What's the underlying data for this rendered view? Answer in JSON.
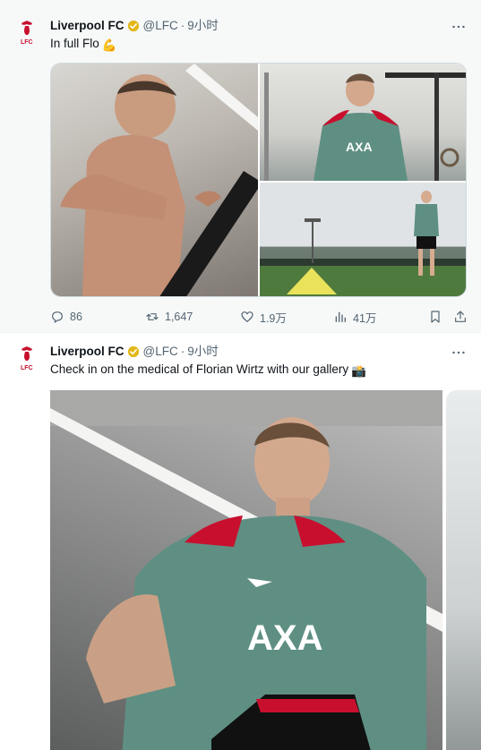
{
  "tweets": [
    {
      "author_name": "Liverpool FC",
      "handle": "@LFC",
      "separator": "·",
      "time": "9小时",
      "text": "In full Flo",
      "text_emoji": "💪",
      "stats": {
        "replies": "86",
        "reposts": "1,647",
        "likes": "1.9万",
        "views": "41万"
      }
    },
    {
      "author_name": "Liverpool FC",
      "handle": "@LFC",
      "separator": "·",
      "time": "9小时",
      "text": "Check in on the medical of Florian Wirtz with our gallery",
      "text_emoji": "📸"
    }
  ],
  "photos": {
    "t1_p1": "Player on treadmill shirtless",
    "t1_p2": "Player in green training top indoor gym",
    "t1_p3": "Player on training pitch with cones",
    "t2_p1": "Player in green AXA training top in gym",
    "t2_p2": "Next gallery photo"
  },
  "colors": {
    "kit_green": "#5f8f83",
    "kit_red": "#c8102e",
    "verified_gold": "#e2b719",
    "muted_text": "#536471"
  }
}
